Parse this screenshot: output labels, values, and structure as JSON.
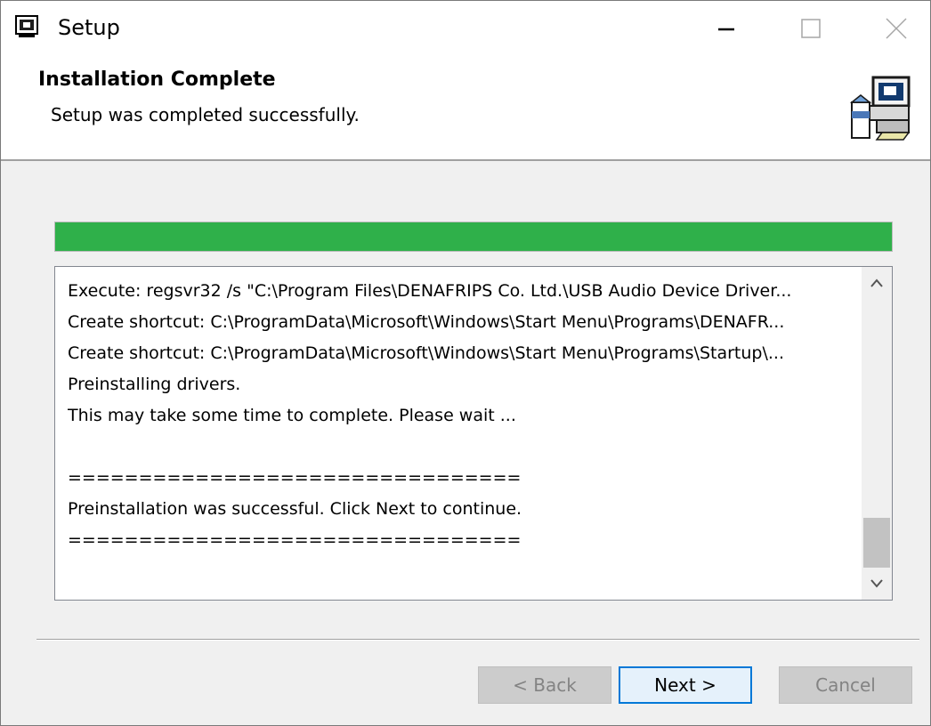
{
  "window": {
    "title": "Setup"
  },
  "header": {
    "title": "Installation Complete",
    "subtitle": "Setup was completed successfully."
  },
  "progress": {
    "value_percent": 100,
    "color": "#2fb04a"
  },
  "log": {
    "lines": [
      "Execute: regsvr32 /s \"C:\\Program Files\\DENAFRIPS Co. Ltd.\\USB Audio Device Driver...",
      "Create shortcut: C:\\ProgramData\\Microsoft\\Windows\\Start Menu\\Programs\\DENAFR...",
      "Create shortcut: C:\\ProgramData\\Microsoft\\Windows\\Start Menu\\Programs\\Startup\\...",
      "Preinstalling drivers.",
      "This may take some time to complete. Please wait ...",
      "",
      "================================",
      "Preinstallation was successful. Click Next to continue.",
      "================================"
    ],
    "scroll_position_percent": 100
  },
  "buttons": {
    "back": "< Back",
    "next": "Next >",
    "cancel": "Cancel"
  },
  "icons": {
    "app": "setup-app-icon",
    "header": "computer-install-icon",
    "minimize": "minimize-icon",
    "maximize": "maximize-icon",
    "close": "close-icon",
    "scroll_up": "chevron-up-icon",
    "scroll_down": "chevron-down-icon"
  }
}
